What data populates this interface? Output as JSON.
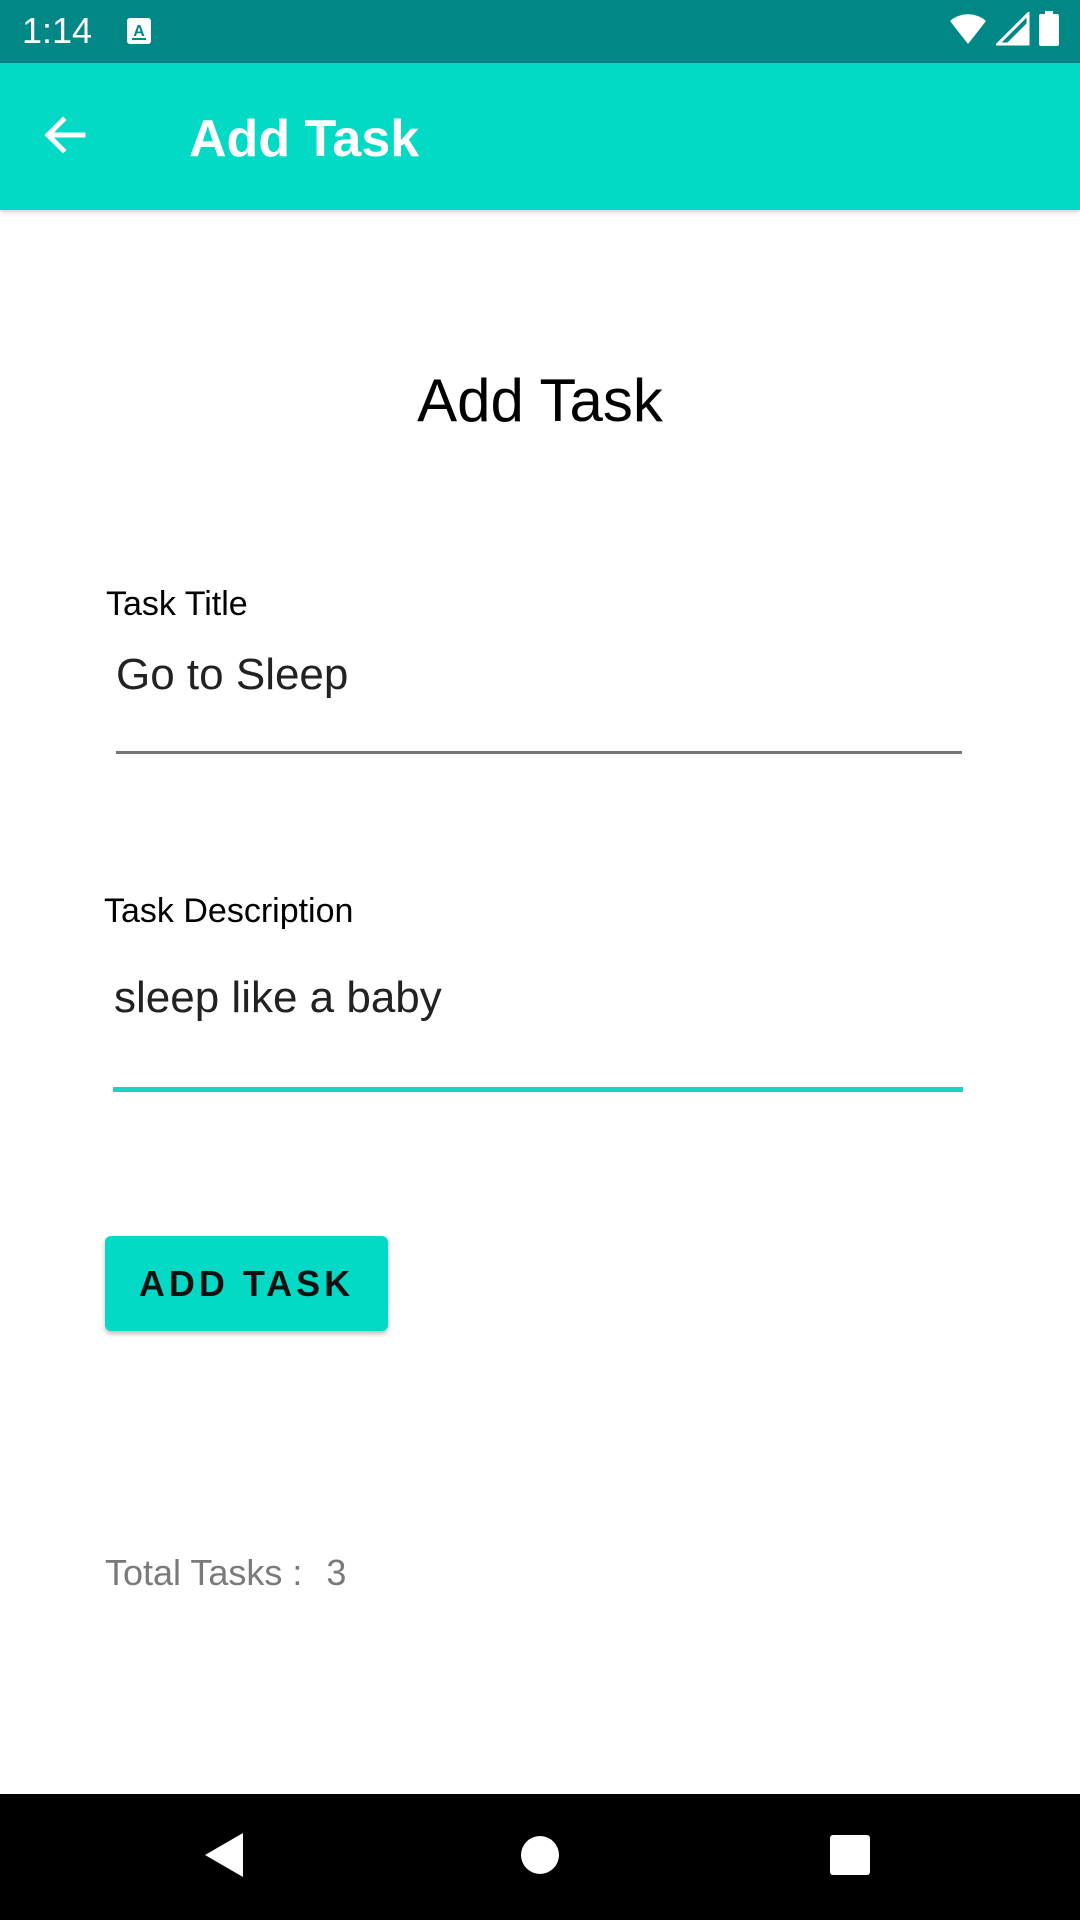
{
  "status_bar": {
    "time": "1:14",
    "background": "#018786",
    "icons": [
      "a-notification-icon",
      "wifi-icon",
      "cell-signal-icon",
      "battery-icon"
    ]
  },
  "app_bar": {
    "title": "Add Task",
    "background": "#03DAC5",
    "back_icon": "arrow-back-icon"
  },
  "form": {
    "heading": "Add Task",
    "title_field": {
      "label": "Task Title",
      "value": "Go to Sleep"
    },
    "description_field": {
      "label": "Task Description",
      "value": "sleep like a baby",
      "focused_underline_color": "#19D3C4"
    },
    "submit_label": "ADD TASK"
  },
  "summary": {
    "label": "Total Tasks :",
    "count": "3"
  },
  "nav_bar": {
    "icons": [
      "back-triangle-icon",
      "home-circle-icon",
      "recents-square-icon"
    ]
  }
}
